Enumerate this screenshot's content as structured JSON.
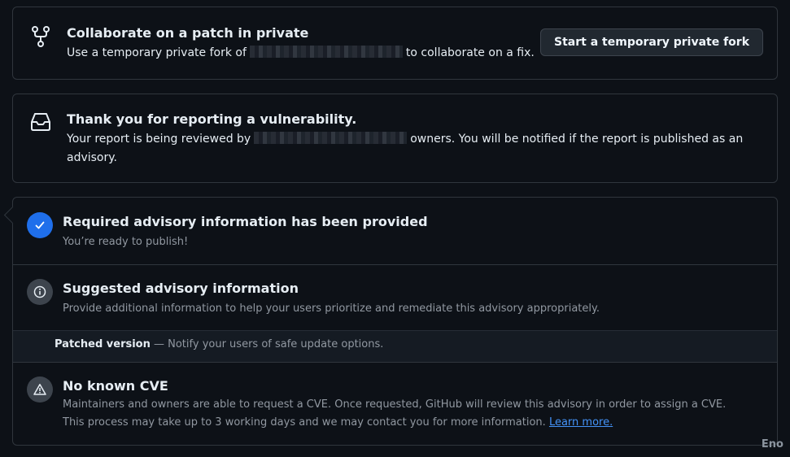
{
  "fork": {
    "title": "Collaborate on a patch in private",
    "desc_before": "Use a temporary private fork of",
    "desc_after": "to collaborate on a fix.",
    "button_label": "Start a temporary private fork",
    "icon": "git-fork-icon"
  },
  "thanks": {
    "title": "Thank you for reporting a vulnerability.",
    "desc_before": "Your report is being reviewed by",
    "desc_after": "owners. You will be notified if the report is published as an",
    "desc_line2": "advisory.",
    "icon": "inbox-icon"
  },
  "required": {
    "title": "Required advisory information has been provided",
    "desc": "You’re ready to publish!",
    "icon": "check-circle-icon"
  },
  "suggested": {
    "title": "Suggested advisory information",
    "desc": "Provide additional information to help your users prioritize and remediate this advisory appropriately.",
    "icon": "info-icon"
  },
  "patched": {
    "label": "Patched version",
    "desc": "— Notify your users of safe update options."
  },
  "cve": {
    "title": "No known CVE",
    "desc_line1": "Maintainers and owners are able to request a CVE. Once requested, GitHub will review this advisory in order to assign a CVE.",
    "desc_line2": "This process may take up to 3 working days and we may contact you for more information.",
    "link": "Learn more.",
    "icon": "alert-icon"
  },
  "watermark": "Eno",
  "colors": {
    "background": "#0d1117",
    "border": "#30363d",
    "accent_blue": "#1f6feb",
    "link": "#4493f8",
    "muted": "#9198a1"
  }
}
